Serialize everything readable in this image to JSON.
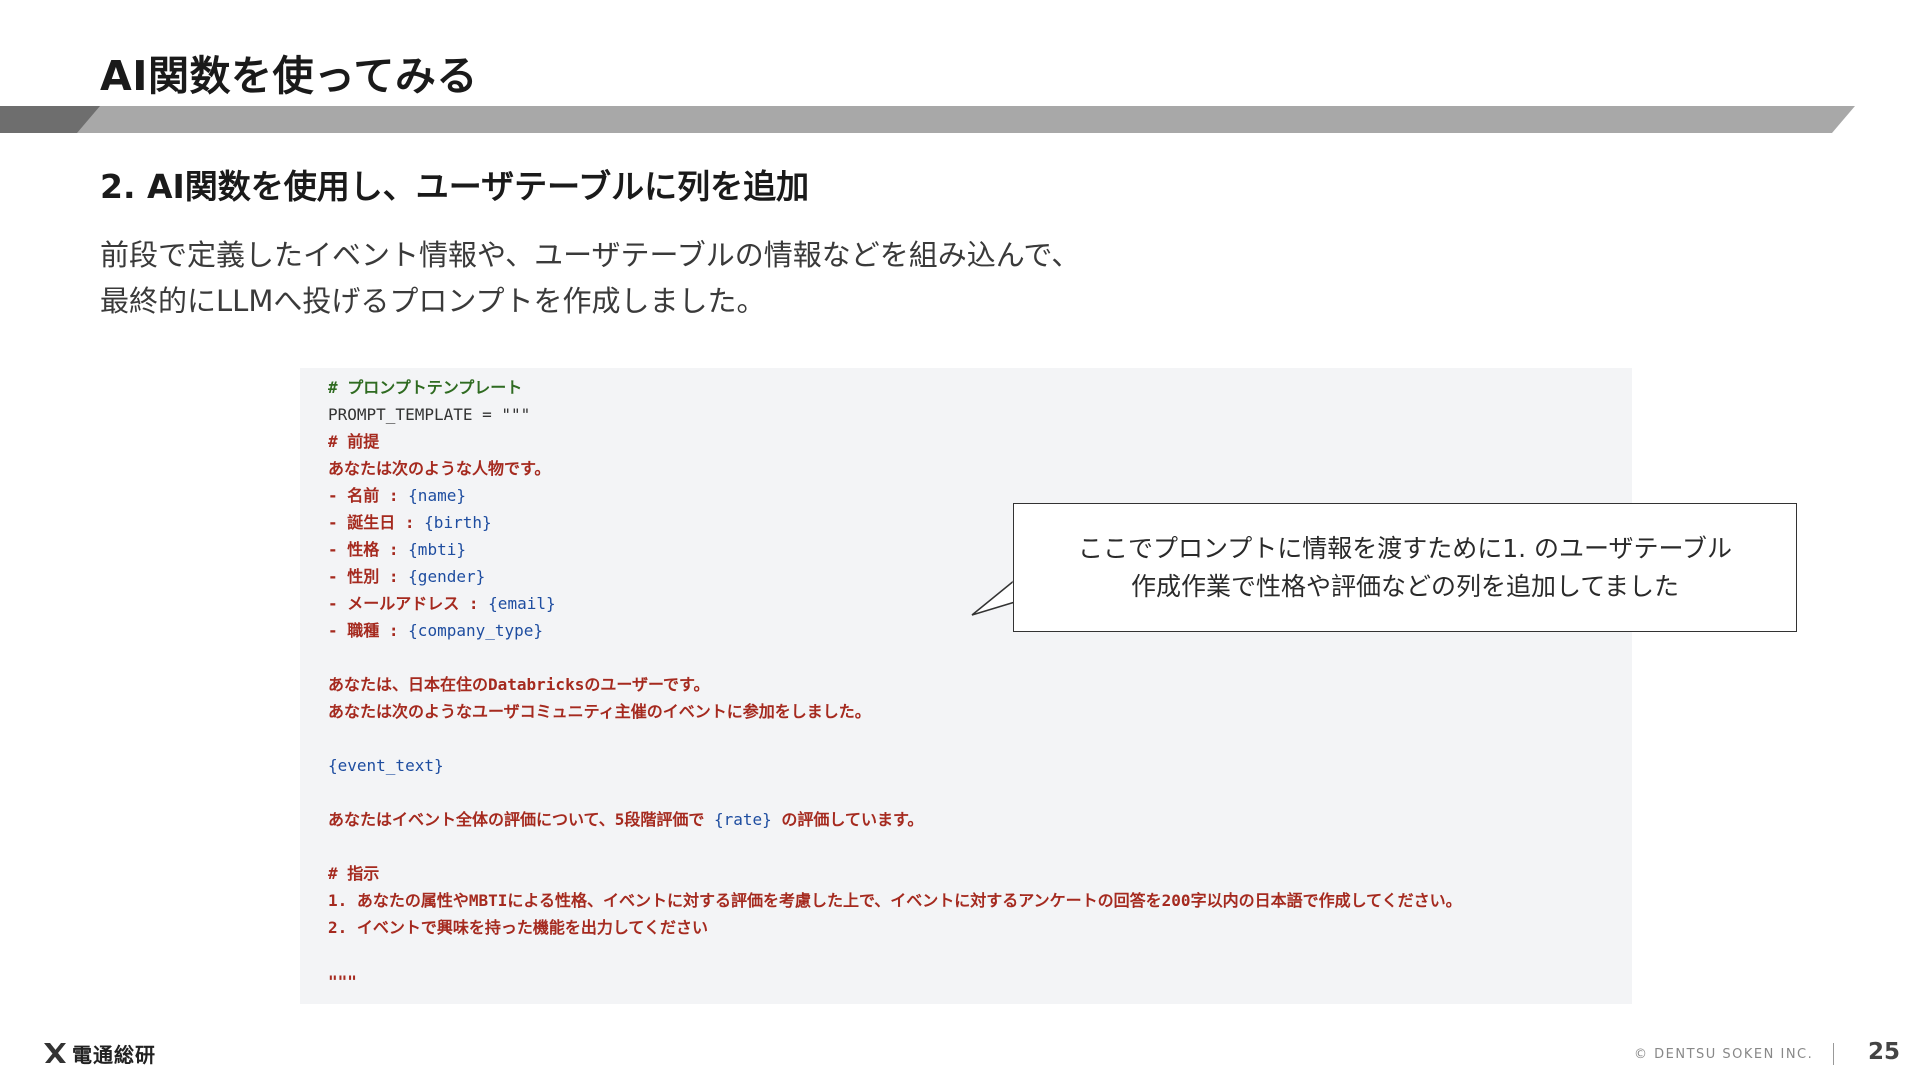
{
  "slide": {
    "title": "AI関数を使ってみる",
    "section_heading": "2. AI関数を使用し、ユーザテーブルに列を追加",
    "description_lines": [
      "前段で定義したイベント情報や、ユーザテーブルの情報などを組み込んで、",
      "最終的にLLMへ投げるプロンプトを作成しました。"
    ]
  },
  "code": {
    "lines": [
      [
        {
          "t": "# プロンプトテンプレート",
          "k": "comment"
        }
      ],
      [
        {
          "t": "PROMPT_TEMPLATE = \"\"\"",
          "k": "plain"
        }
      ],
      [
        {
          "t": "# 前提",
          "k": "text"
        }
      ],
      [
        {
          "t": "あなたは次のような人物です。",
          "k": "text"
        }
      ],
      [
        {
          "t": "- 名前 : ",
          "k": "text"
        },
        {
          "t": "{name}",
          "k": "var"
        }
      ],
      [
        {
          "t": "- 誕生日 : ",
          "k": "text"
        },
        {
          "t": "{birth}",
          "k": "var"
        }
      ],
      [
        {
          "t": "- 性格 : ",
          "k": "text"
        },
        {
          "t": "{mbti}",
          "k": "var"
        }
      ],
      [
        {
          "t": "- 性別 : ",
          "k": "text"
        },
        {
          "t": "{gender}",
          "k": "var"
        }
      ],
      [
        {
          "t": "- メールアドレス : ",
          "k": "text"
        },
        {
          "t": "{email}",
          "k": "var"
        }
      ],
      [
        {
          "t": "- 職種 : ",
          "k": "text"
        },
        {
          "t": "{company_type}",
          "k": "var"
        }
      ],
      [],
      [
        {
          "t": "あなたは、日本在住のDatabricksのユーザーです。",
          "k": "text"
        }
      ],
      [
        {
          "t": "あなたは次のようなユーザコミュニティ主催のイベントに参加をしました。",
          "k": "text"
        }
      ],
      [],
      [
        {
          "t": "{event_text}",
          "k": "var"
        }
      ],
      [],
      [
        {
          "t": "あなたはイベント全体の評価について、5段階評価で ",
          "k": "text"
        },
        {
          "t": "{rate}",
          "k": "var"
        },
        {
          "t": " の評価しています。",
          "k": "text"
        }
      ],
      [],
      [
        {
          "t": "# 指示",
          "k": "text"
        }
      ],
      [
        {
          "t": "1. あなたの属性やMBTIによる性格、イベントに対する評価を考慮した上で、イベントに対するアンケートの回答を200字以内の日本語で作成してください。",
          "k": "text"
        }
      ],
      [
        {
          "t": "2. イベントで興味を持った機能を出力してください",
          "k": "text"
        }
      ],
      [],
      [
        {
          "t": "\"\"\"",
          "k": "text"
        }
      ]
    ]
  },
  "callout": {
    "lines": [
      "ここでプロンプトに情報を渡すために1. のユーザテーブル",
      "作成作業で性格や評価などの列を追加してました"
    ]
  },
  "footer": {
    "logo_text": "電通総研",
    "copyright": "© DENTSU SOKEN INC.",
    "page_number": "25"
  },
  "colors": {
    "title_bar_dark": "#6e6e6e",
    "title_bar_light": "#a8a8a8",
    "code_background": "#f3f4f6",
    "code_comment": "#2f6b21",
    "code_text": "#a52a1f",
    "code_variable": "#1e4da0"
  }
}
